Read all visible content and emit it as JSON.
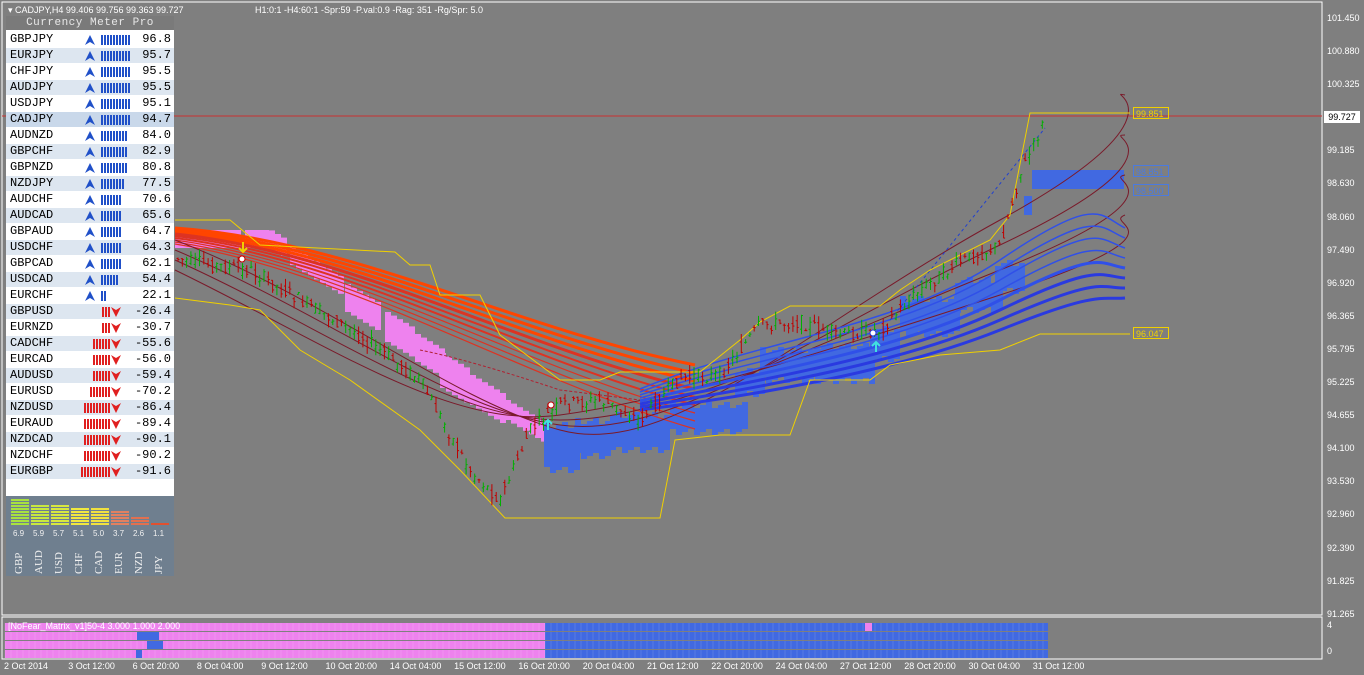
{
  "window": {
    "symbol_label": "CADJPY,H4",
    "ohlc": "99.406 99.756 99.363 99.727",
    "info": "H1:0:1 -H4:60:1 -Spr:59 -P.val:0.9 -Rag: 351 -Rg/Spr: 5.0"
  },
  "meter": {
    "title": "Currency Meter Pro",
    "pairs": [
      {
        "name": "GBPJPY",
        "value": "96.8",
        "bars": 10,
        "dir": "up"
      },
      {
        "name": "EURJPY",
        "value": "95.7",
        "bars": 10,
        "dir": "up"
      },
      {
        "name": "CHFJPY",
        "value": "95.5",
        "bars": 10,
        "dir": "up"
      },
      {
        "name": "AUDJPY",
        "value": "95.5",
        "bars": 10,
        "dir": "up"
      },
      {
        "name": "USDJPY",
        "value": "95.1",
        "bars": 10,
        "dir": "up"
      },
      {
        "name": "CADJPY",
        "value": "94.7",
        "bars": 10,
        "dir": "up"
      },
      {
        "name": "AUDNZD",
        "value": "84.0",
        "bars": 9,
        "dir": "up"
      },
      {
        "name": "GBPCHF",
        "value": "82.9",
        "bars": 9,
        "dir": "up"
      },
      {
        "name": "GBPNZD",
        "value": "80.8",
        "bars": 9,
        "dir": "up"
      },
      {
        "name": "NZDJPY",
        "value": "77.5",
        "bars": 8,
        "dir": "up"
      },
      {
        "name": "AUDCHF",
        "value": "70.6",
        "bars": 7,
        "dir": "up"
      },
      {
        "name": "AUDCAD",
        "value": "65.6",
        "bars": 7,
        "dir": "up"
      },
      {
        "name": "GBPAUD",
        "value": "64.7",
        "bars": 7,
        "dir": "up"
      },
      {
        "name": "USDCHF",
        "value": "64.3",
        "bars": 7,
        "dir": "up"
      },
      {
        "name": "GBPCAD",
        "value": "62.1",
        "bars": 7,
        "dir": "up"
      },
      {
        "name": "USDCAD",
        "value": "54.4",
        "bars": 6,
        "dir": "up"
      },
      {
        "name": "EURCHF",
        "value": "22.1",
        "bars": 2,
        "dir": "up"
      },
      {
        "name": "GBPUSD",
        "value": "-26.4",
        "bars": 3,
        "dir": "down"
      },
      {
        "name": "EURNZD",
        "value": "-30.7",
        "bars": 3,
        "dir": "down"
      },
      {
        "name": "CADCHF",
        "value": "-55.6",
        "bars": 6,
        "dir": "down"
      },
      {
        "name": "EURCAD",
        "value": "-56.0",
        "bars": 6,
        "dir": "down"
      },
      {
        "name": "AUDUSD",
        "value": "-59.4",
        "bars": 6,
        "dir": "down"
      },
      {
        "name": "EURUSD",
        "value": "-70.2",
        "bars": 7,
        "dir": "down"
      },
      {
        "name": "NZDUSD",
        "value": "-86.4",
        "bars": 9,
        "dir": "down"
      },
      {
        "name": "EURAUD",
        "value": "-89.4",
        "bars": 9,
        "dir": "down"
      },
      {
        "name": "NZDCAD",
        "value": "-90.1",
        "bars": 9,
        "dir": "down"
      },
      {
        "name": "NZDCHF",
        "value": "-90.2",
        "bars": 9,
        "dir": "down"
      },
      {
        "name": "EURGBP",
        "value": "-91.6",
        "bars": 10,
        "dir": "down"
      }
    ],
    "currencies": [
      {
        "code": "GBP",
        "value": "6.9",
        "color": "#a8e040"
      },
      {
        "code": "AUD",
        "value": "5.9",
        "color": "#c8e840"
      },
      {
        "code": "USD",
        "value": "5.7",
        "color": "#d8e840"
      },
      {
        "code": "CHF",
        "value": "5.1",
        "color": "#f0e840"
      },
      {
        "code": "CAD",
        "value": "5.0",
        "color": "#f0e040"
      },
      {
        "code": "EUR",
        "value": "3.7",
        "color": "#e08060"
      },
      {
        "code": "NZD",
        "value": "2.6",
        "color": "#e07050"
      },
      {
        "code": "JPY",
        "value": "1.1",
        "color": "#e05030"
      }
    ],
    "up_color": "#2050c8",
    "down_color": "#e02020"
  },
  "price_axis": [
    "101.450",
    "100.880",
    "100.325",
    "99.727",
    "99.185",
    "98.630",
    "98.060",
    "97.490",
    "96.920",
    "96.365",
    "95.795",
    "95.225",
    "94.655",
    "94.100",
    "93.530",
    "92.960",
    "92.390",
    "91.825",
    "91.265"
  ],
  "current_price": "99.727",
  "levels": [
    {
      "label": "99.851",
      "color": "#f0d000"
    },
    {
      "label": "98.851",
      "color": "#4a7ae0"
    },
    {
      "label": "98.500",
      "color": "#4a7ae0"
    },
    {
      "label": "96.047",
      "color": "#f0d000"
    }
  ],
  "dates": [
    "2 Oct 2014",
    "3 Oct 12:00",
    "6 Oct 20:00",
    "8 Oct 04:00",
    "9 Oct 12:00",
    "10 Oct 20:00",
    "14 Oct 04:00",
    "15 Oct 12:00",
    "16 Oct 20:00",
    "20 Oct 04:00",
    "21 Oct 12:00",
    "22 Oct 20:00",
    "24 Oct 04:00",
    "27 Oct 12:00",
    "28 Oct 20:00",
    "30 Oct 04:00",
    "31 Oct 12:00"
  ],
  "subwindow": {
    "title": "[NoFear_Matrix_v1]50-4 3.000 1.000 2.000",
    "scale_top": "4",
    "scale_bottom": "0"
  },
  "colors": {
    "background": "#7f7f7f",
    "bull": "#00b000",
    "bear": "#c00000",
    "yellow": "#f0d000",
    "pink": "#ee82ee",
    "blue": "#4169e1"
  }
}
